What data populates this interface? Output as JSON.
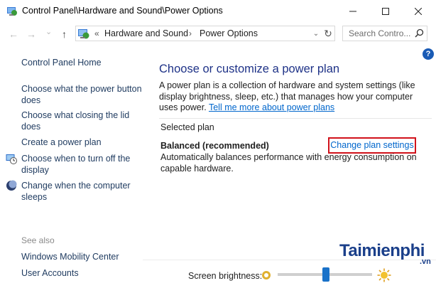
{
  "window": {
    "title": "Control Panel\\Hardware and Sound\\Power Options",
    "icon": "control-panel-icon",
    "minimize_label": "—",
    "maximize_label": "☐",
    "close_label": "✕"
  },
  "nav": {
    "back_label": "←",
    "forward_label": "→",
    "recent_label": "⌄",
    "up_label": "↑",
    "crumb_prefix": "«",
    "breadcrumbs": [
      "Hardware and Sound",
      "Power Options"
    ],
    "crumb_separator": "›",
    "dropdown_label": "⌄",
    "refresh_label": "↻",
    "search_placeholder": "Search Contro..."
  },
  "help": {
    "label": "?"
  },
  "sidebar": {
    "home": "Control Panel Home",
    "links": [
      {
        "lines": [
          "Choose what the power button",
          "does"
        ],
        "icon": null
      },
      {
        "lines": [
          "Choose what closing the lid",
          "does"
        ],
        "icon": null
      },
      {
        "lines": [
          "Create a power plan"
        ],
        "icon": null
      },
      {
        "lines": [
          "Choose when to turn off the",
          "display"
        ],
        "icon": "display-clock-icon"
      },
      {
        "lines": [
          "Change when the computer",
          "sleeps"
        ],
        "icon": "moon-icon"
      }
    ],
    "see_also_label": "See also",
    "see_also": [
      "Windows Mobility Center",
      "User Accounts"
    ]
  },
  "main": {
    "title": "Choose or customize a power plan",
    "description": "A power plan is a collection of hardware and system settings (like display brightness, sleep, etc.) that manages how your computer uses power.",
    "learn_more": "Tell me more about power plans",
    "selected_plan_label": "Selected plan",
    "plan_name": "Balanced (recommended)",
    "change_plan_link": "Change plan settings",
    "plan_description": "Automatically balances performance with energy consumption on capable hardware.",
    "brightness_label": "Screen brightness:",
    "brightness_value": 0.51
  },
  "watermark": {
    "text": "Taimienphi",
    "suffix": ".vn"
  },
  "colors": {
    "title_blue": "#1e3287",
    "link_blue": "#0066cc",
    "highlight_red": "#d1121b",
    "slider_blue": "#1a72c9"
  }
}
